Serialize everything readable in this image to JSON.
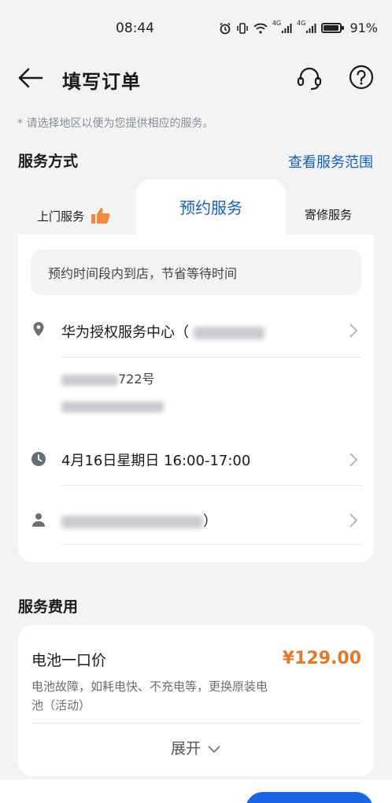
{
  "status_bar": {
    "time": "08:44",
    "signal_label_1": "4G",
    "signal_label_2": "4G",
    "battery": "91%"
  },
  "header": {
    "title": "填写订单"
  },
  "hint": "* 请选择地区以便为您提供相应的服务。",
  "service_method": {
    "title": "服务方式",
    "range_link": "查看服务范围",
    "tabs": [
      {
        "label": "上门服务"
      },
      {
        "label": "预约服务"
      },
      {
        "label": "寄修服务"
      }
    ],
    "active_tab": "预约服务",
    "notice": "预约时间段内到店，节省等待时间",
    "store_name": "华为授权服务中心（",
    "address_partial": "722号",
    "appointment_time": "4月16日星期日 16:00-17:00",
    "contact_suffix": "）"
  },
  "service_fee": {
    "title": "服务费用",
    "item_name": "电池一口价",
    "item_price": "¥129.00",
    "item_desc": "电池故障，如耗电快、不充电等，更换原装电池（活动）",
    "expand": "展开"
  },
  "colors": {
    "accent": "#1a5fb4",
    "price": "#e07a2e",
    "primary_button": "#1a66e6",
    "thumb_icon": "#f08a3c"
  }
}
